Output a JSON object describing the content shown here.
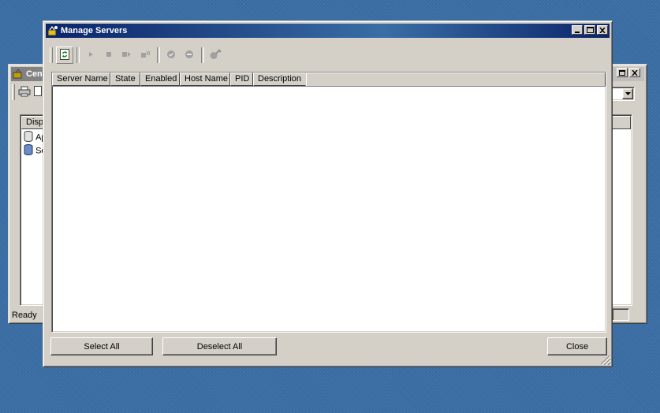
{
  "colors": {
    "desktop": "#3a6ea5",
    "active_title": "#0a246a",
    "inactive_title": "#808080",
    "face": "#d4d0c8"
  },
  "background_window": {
    "title": "Cen",
    "status": "Ready",
    "tree_header": "Displ",
    "tree_items": [
      "Ap",
      "Se"
    ]
  },
  "dialog": {
    "title": "Manage Servers",
    "toolbar": {
      "refresh_icon": "refresh-icon",
      "start_icon": "play-icon",
      "stop_icon": "stop-icon",
      "restart_icon": "restart-icon",
      "pause_icon": "pause-icon",
      "enable_icon": "enable-icon",
      "disable_icon": "disable-icon",
      "properties_icon": "wrench-icon"
    },
    "columns": [
      "Server Name",
      "State",
      "Enabled",
      "Host Name",
      "PID",
      "Description"
    ],
    "rows": [],
    "buttons": {
      "select_all": "Select All",
      "deselect_all": "Deselect All",
      "close": "Close"
    }
  }
}
